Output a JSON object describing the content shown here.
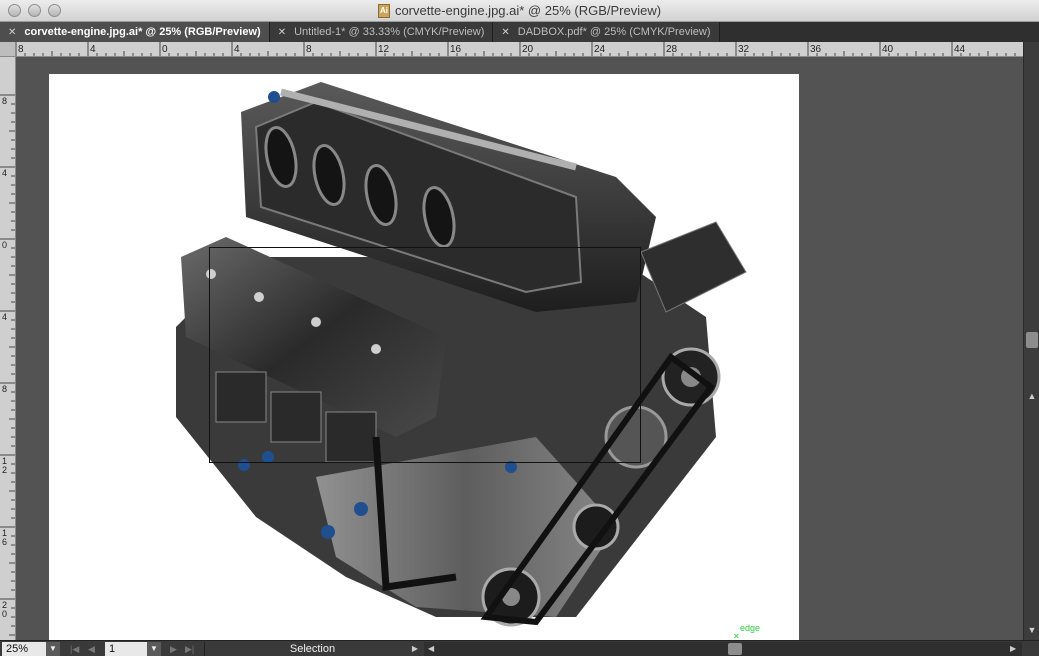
{
  "window": {
    "title": "corvette-engine.jpg.ai* @ 25% (RGB/Preview)",
    "doc_icon": "Ai"
  },
  "tabs": [
    {
      "label": "corvette-engine.jpg.ai* @ 25% (RGB/Preview)",
      "active": true
    },
    {
      "label": "Untitled-1* @ 33.33% (CMYK/Preview)",
      "active": false
    },
    {
      "label": "DADBOX.pdf* @ 25% (CMYK/Preview)",
      "active": false
    }
  ],
  "rulers": {
    "horizontal_labels": [
      "8",
      "4",
      "0",
      "4",
      "8",
      "12",
      "16",
      "20",
      "24",
      "28",
      "32",
      "36",
      "40",
      "44"
    ],
    "vertical_labels": [
      "8",
      "4",
      "0",
      "4",
      "8",
      "1 2",
      "1 6",
      "2 0"
    ]
  },
  "canvas": {
    "smart_guide_label": "edge",
    "smart_guide_color": "#2ecc40",
    "artboard_color": "#ffffff",
    "pasteboard_color": "#535353"
  },
  "status": {
    "zoom": "25%",
    "page": "1",
    "tool_readout": "Selection"
  },
  "icons": [
    "close-icon",
    "chevron-down-icon",
    "first-page-icon",
    "prev-page-icon",
    "next-page-icon",
    "last-page-icon",
    "scroll-left-icon",
    "scroll-right-icon",
    "scroll-up-icon",
    "scroll-down-icon"
  ]
}
